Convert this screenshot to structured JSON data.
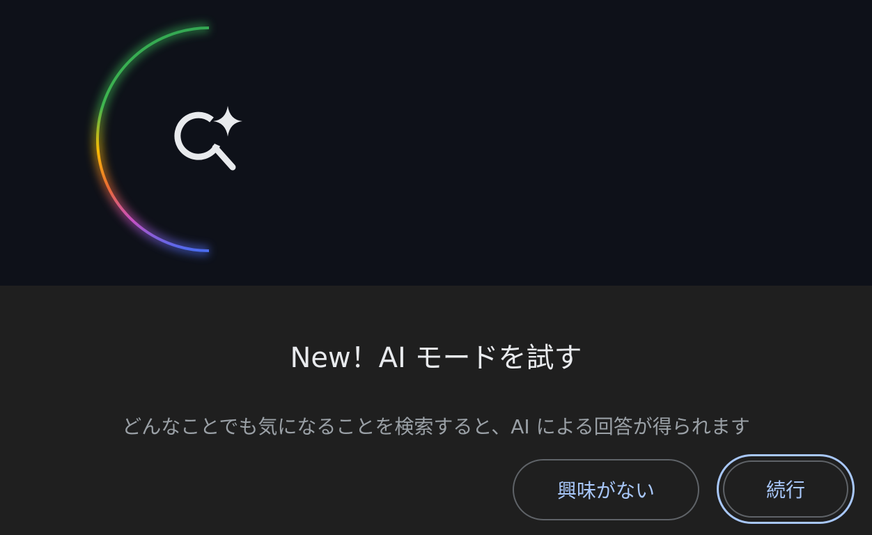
{
  "dialog": {
    "title": "New！AI モードを試す",
    "description": "どんなことでも気になることを検索すると、AI による回答が得られます",
    "hero_icon": "search-sparkle-icon",
    "colors": {
      "hero_background": "#0e1119",
      "dialog_background": "#1f1f1f",
      "accent": "#a8c7fa",
      "glow_green": "#34a853",
      "glow_yellow": "#fbbc04",
      "glow_red": "#ea4335",
      "glow_blue": "#4285f4"
    },
    "buttons": {
      "dismiss_label": "興味がない",
      "continue_label": "続行"
    }
  }
}
